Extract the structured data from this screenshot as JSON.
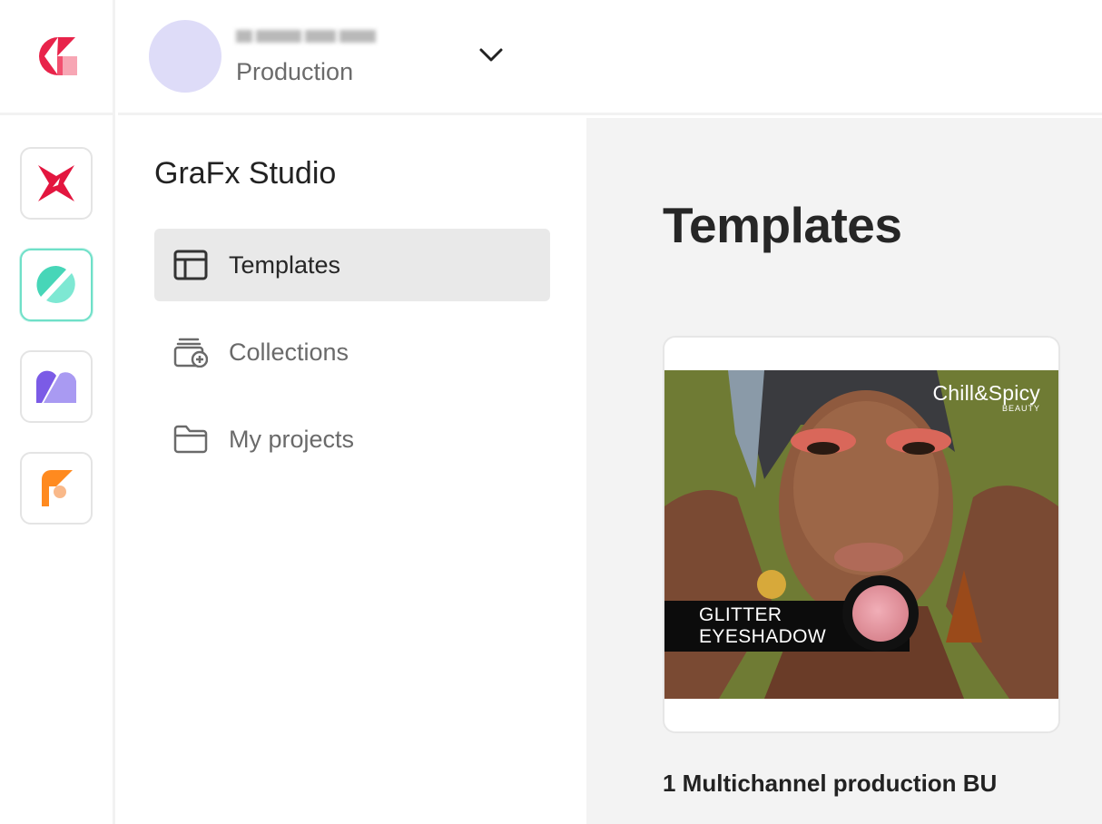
{
  "header": {
    "environment_subtitle": "Production"
  },
  "apps": [
    {
      "name": "GraFx Publisher"
    },
    {
      "name": "GraFx Studio"
    },
    {
      "name": "GraFx Media"
    },
    {
      "name": "GraFx Fonts"
    }
  ],
  "sidenav": {
    "title": "GraFx Studio",
    "items": [
      {
        "label": "Templates",
        "icon": "template-layout-icon",
        "active": true
      },
      {
        "label": "Collections",
        "icon": "collections-add-icon",
        "active": false
      },
      {
        "label": "My projects",
        "icon": "folder-icon",
        "active": false
      }
    ]
  },
  "main": {
    "title": "Templates",
    "templates": [
      {
        "name": "1 Multichannel production BU",
        "thumbnail": {
          "brand": "Chill&Spicy",
          "brand_sub": "BEAUTY",
          "banner_line1": "GLITTER",
          "banner_line2": "EYESHADOW"
        }
      }
    ]
  },
  "colors": {
    "accent_studio": "#6fe0c8",
    "nav_active_bg": "#e9e9e9",
    "main_bg": "#f3f3f3",
    "avatar_bg": "#dedcf8"
  }
}
